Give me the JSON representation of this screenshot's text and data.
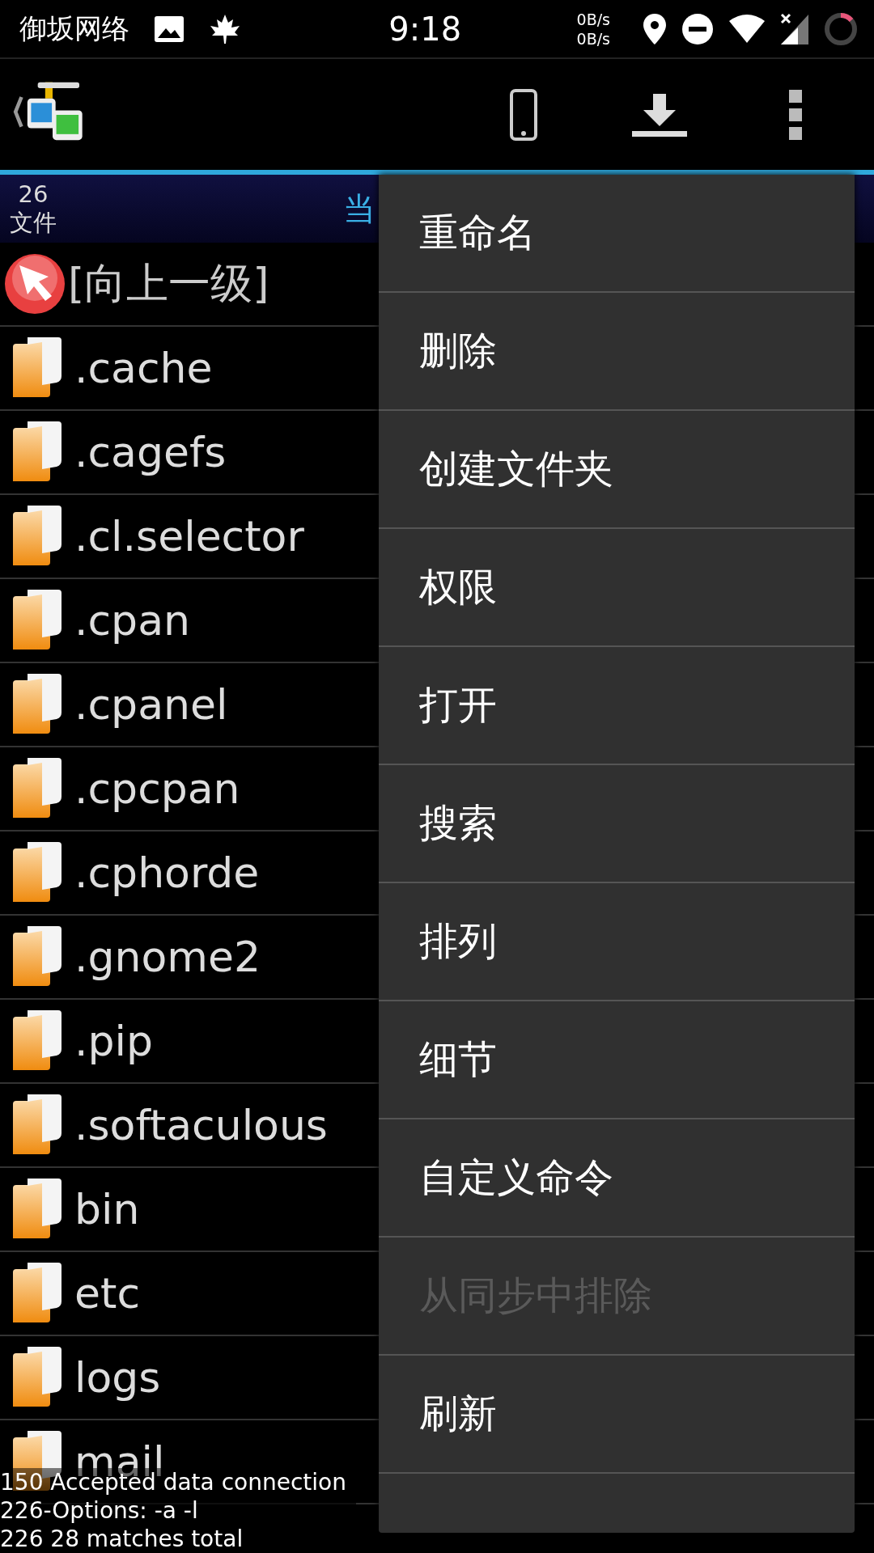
{
  "status_bar": {
    "carrier": "御坂网络",
    "time": "9:18",
    "net_up": "0B/s",
    "net_down": "0B/s"
  },
  "header": {
    "count": "26",
    "count_label": "文件",
    "path_fragment": "当"
  },
  "files": [
    {
      "name": "[向上一级]",
      "kind": "parent"
    },
    {
      "name": ".cache",
      "kind": "folder"
    },
    {
      "name": ".cagefs",
      "kind": "folder"
    },
    {
      "name": ".cl.selector",
      "kind": "folder"
    },
    {
      "name": ".cpan",
      "kind": "folder"
    },
    {
      "name": ".cpanel",
      "kind": "folder"
    },
    {
      "name": ".cpcpan",
      "kind": "folder"
    },
    {
      "name": ".cphorde",
      "kind": "folder"
    },
    {
      "name": ".gnome2",
      "kind": "folder"
    },
    {
      "name": ".pip",
      "kind": "folder"
    },
    {
      "name": ".softaculous",
      "kind": "folder"
    },
    {
      "name": "bin",
      "kind": "folder"
    },
    {
      "name": "etc",
      "kind": "folder"
    },
    {
      "name": "logs",
      "kind": "folder"
    },
    {
      "name": "mail",
      "kind": "folder"
    }
  ],
  "menu": [
    {
      "label": "重命名",
      "disabled": false
    },
    {
      "label": "删除",
      "disabled": false
    },
    {
      "label": "创建文件夹",
      "disabled": false
    },
    {
      "label": "权限",
      "disabled": false
    },
    {
      "label": "打开",
      "disabled": false
    },
    {
      "label": "搜索",
      "disabled": false
    },
    {
      "label": "排列",
      "disabled": false
    },
    {
      "label": "细节",
      "disabled": false
    },
    {
      "label": "自定义命令",
      "disabled": false
    },
    {
      "label": "从同步中排除",
      "disabled": true
    },
    {
      "label": "刷新",
      "disabled": false
    }
  ],
  "log": [
    "150 Accepted data connection",
    "226-Options: -a -l",
    "226 28 matches total"
  ]
}
